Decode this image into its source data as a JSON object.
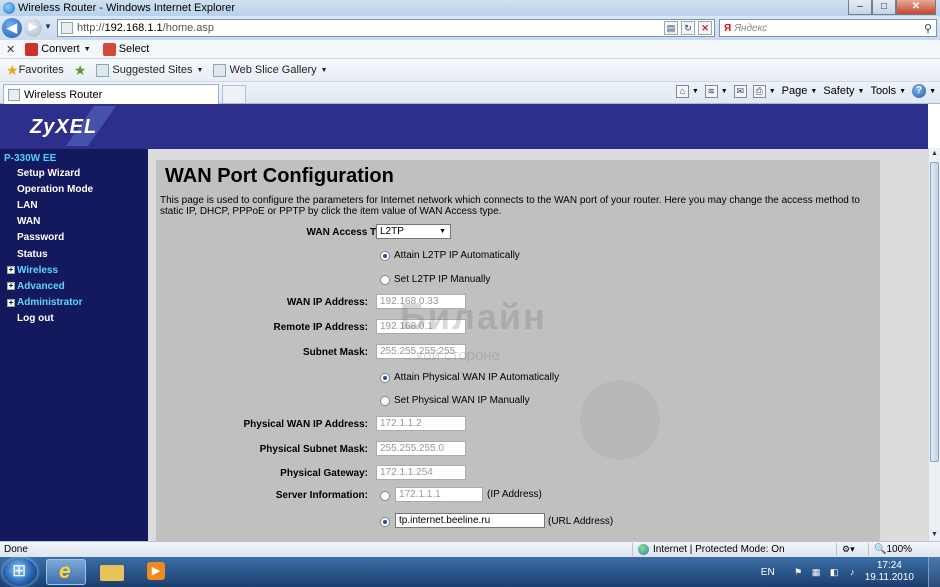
{
  "window": {
    "title": "Wireless Router - Windows Internet Explorer",
    "min": "–",
    "max": "□",
    "close": "✕"
  },
  "address": {
    "url_prefix": "http://",
    "url_host": "192.168.1.1",
    "url_path": "/home.asp"
  },
  "search": {
    "engine": "Я",
    "placeholder": "Яндекс"
  },
  "cmdbar": {
    "close": "✕",
    "convert": "Convert",
    "select": "Select"
  },
  "favbar": {
    "favorites": "Favorites",
    "suggested": "Suggested Sites",
    "webslice": "Web Slice Gallery"
  },
  "tab": {
    "label": "Wireless Router"
  },
  "tabtools": {
    "page": "Page",
    "safety": "Safety",
    "tools": "Tools",
    "help": "?"
  },
  "brand": {
    "logo": "ZyXEL"
  },
  "sidebar": {
    "model": "P-330W EE",
    "items": [
      {
        "label": "Setup Wizard",
        "group": false
      },
      {
        "label": "Operation Mode",
        "group": false
      },
      {
        "label": "LAN",
        "group": false
      },
      {
        "label": "WAN",
        "group": false
      },
      {
        "label": "Password",
        "group": false
      },
      {
        "label": "Status",
        "group": false
      },
      {
        "label": "Wireless",
        "group": true
      },
      {
        "label": "Advanced",
        "group": true
      },
      {
        "label": "Administrator",
        "group": true
      },
      {
        "label": "Log out",
        "group": false
      }
    ]
  },
  "main": {
    "title": "WAN Port Configuration",
    "description": "This page is used to configure the parameters for Internet network which connects to the WAN port of your router. Here you may change the access method to static IP, DHCP, PPPoE or PPTP by click the item value of WAN Access type.",
    "wan_access_type": {
      "label": "WAN Access Type:",
      "value": "L2TP"
    },
    "l2tp_auto": "Attain L2TP IP Automatically",
    "l2tp_manual": "Set L2TP IP Manually",
    "wan_ip": {
      "label": "WAN IP Address:",
      "value": "192.168.0.33"
    },
    "remote_ip": {
      "label": "Remote IP Address:",
      "value": "192.168.0.1"
    },
    "subnet": {
      "label": "Subnet Mask:",
      "value": "255.255.255.255"
    },
    "phys_auto": "Attain Physical WAN IP Automatically",
    "phys_manual": "Set Physical WAN IP Manually",
    "phys_ip": {
      "label": "Physical WAN IP Address:",
      "value": "172.1.1.2"
    },
    "phys_mask": {
      "label": "Physical Subnet Mask:",
      "value": "255.255.255.0"
    },
    "phys_gw": {
      "label": "Physical Gateway:",
      "value": "172.1.1.254"
    },
    "server_info": {
      "label": "Server Information:",
      "ip_value": "172.1.1.1",
      "ip_suffix": "(IP Address)",
      "url_value": "tp.internet.beeline.ru",
      "url_suffix": "(URL Address)"
    },
    "watermark": "Билайн",
    "watermark_sub": "...кой стороне"
  },
  "status": {
    "text": "Done",
    "zone": "Internet | Protected Mode: On",
    "zoom": "🔍100%"
  },
  "taskbar": {
    "lang": "EN",
    "time": "17:24",
    "date": "19.11.2010"
  }
}
